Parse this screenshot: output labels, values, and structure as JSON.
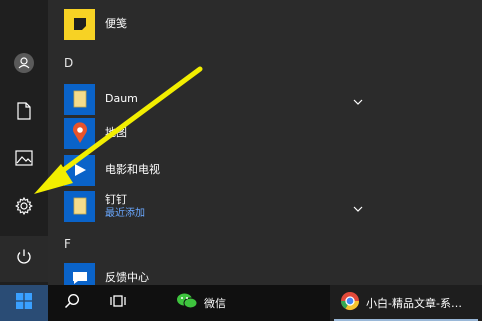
{
  "start_menu": {
    "rail": {
      "user_icon": "user-icon",
      "documents_icon": "document-icon",
      "pictures_icon": "pictures-icon",
      "settings_icon": "gear-icon",
      "power_icon": "power-icon"
    },
    "apps": [
      {
        "label": "便笺",
        "icon": "sticky-notes-icon"
      },
      {
        "section": "D"
      },
      {
        "label": "Daum",
        "icon": "folder-icon",
        "expandable": true
      },
      {
        "label": "地图",
        "icon": "maps-icon"
      },
      {
        "label": "电影和电视",
        "icon": "movies-tv-icon"
      },
      {
        "label": "钉钉",
        "sublabel": "最近添加",
        "icon": "folder-icon",
        "expandable": true
      },
      {
        "section": "F"
      },
      {
        "label": "反馈中心",
        "icon": "feedback-hub-icon"
      }
    ]
  },
  "taskbar": {
    "start_icon": "windows-logo-icon",
    "search_icon": "search-icon",
    "taskview_icon": "task-view-icon",
    "wechat_label": "微信",
    "browser_label": "小白-精品文章-系…"
  },
  "annotation": {
    "color": "#f2ee00"
  },
  "colors": {
    "tile_blue": "#0a63c9",
    "accent": "#f2ee00"
  }
}
